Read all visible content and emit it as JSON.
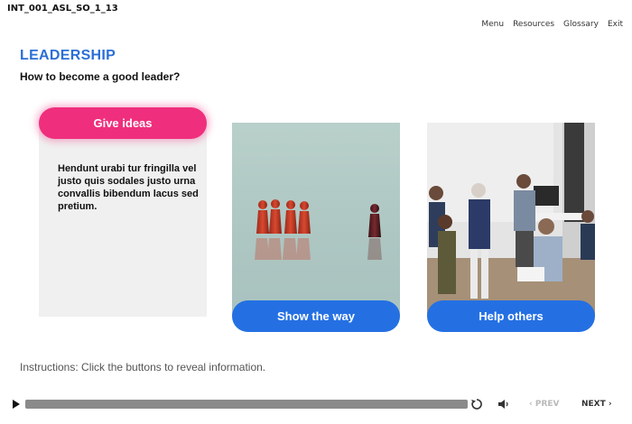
{
  "header": {
    "course_id": "INT_001_ASL_SO_1_13",
    "nav": [
      "Menu",
      "Resources",
      "Glossary",
      "Exit"
    ]
  },
  "page": {
    "title": "LEADERSHIP",
    "subtitle": "How to become a good leader?"
  },
  "cards": [
    {
      "label": "Give ideas",
      "text": "Hendunt urabi tur fringilla vel justo quis sodales justo urna convallis bibendum lacus sed pretium.",
      "state": "selected"
    },
    {
      "label": "Show the way",
      "image": "red pawns facing one dark pawn"
    },
    {
      "label": "Help others",
      "image": "group of business people talking in office"
    }
  ],
  "instructions": "Instructions: Click the buttons to reveal information.",
  "player": {
    "prev_label": "PREV",
    "next_label": "NEXT",
    "progress": 1.0
  },
  "colors": {
    "accent_blue": "#2470e3",
    "title_blue": "#2b6fd6",
    "accent_pink": "#ef2f7d"
  },
  "icons": [
    "play-icon",
    "replay-icon",
    "volume-icon",
    "chevron-left-icon",
    "chevron-right-icon"
  ]
}
